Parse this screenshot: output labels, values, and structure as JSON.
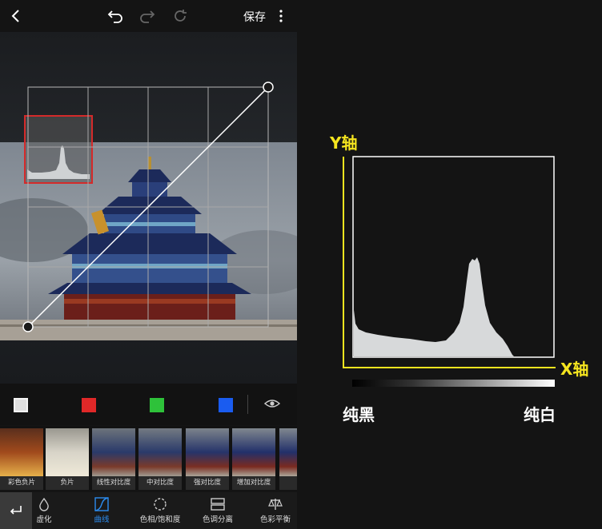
{
  "toolbar": {
    "save_label": "保存",
    "back_icon": "chevron-left-icon",
    "undo_icon": "undo-icon",
    "redo_icon": "redo-icon",
    "reset_icon": "reset-icon",
    "more_icon": "more-vertical-icon"
  },
  "channels": [
    {
      "name": "rgb",
      "color": "#e0e0e0"
    },
    {
      "name": "red",
      "color": "#e02828"
    },
    {
      "name": "green",
      "color": "#2ec23a"
    },
    {
      "name": "blue",
      "color": "#1a5cf0"
    }
  ],
  "presets": [
    {
      "label": "彩色负片"
    },
    {
      "label": "负片"
    },
    {
      "label": "线性对比度"
    },
    {
      "label": "中对比度"
    },
    {
      "label": "强对比度"
    },
    {
      "label": "增加对比度"
    },
    {
      "label": "较"
    }
  ],
  "tools": [
    {
      "label": "虚化",
      "icon": "drop-icon",
      "active": false
    },
    {
      "label": "曲线",
      "icon": "curve-icon",
      "active": true
    },
    {
      "label": "色相/饱和度",
      "icon": "hue-circle-icon",
      "active": false
    },
    {
      "label": "色调分离",
      "icon": "split-tone-icon",
      "active": false
    },
    {
      "label": "色彩平衡",
      "icon": "balance-icon",
      "active": false
    }
  ],
  "diagram": {
    "y_axis_label": "Y轴",
    "x_axis_label": "X轴",
    "black_label": "纯黑",
    "white_label": "纯白",
    "accent_color": "#f5e51f"
  },
  "colors": {
    "highlight_box": "#d42a2a",
    "active_tool": "#2b8cf0"
  }
}
